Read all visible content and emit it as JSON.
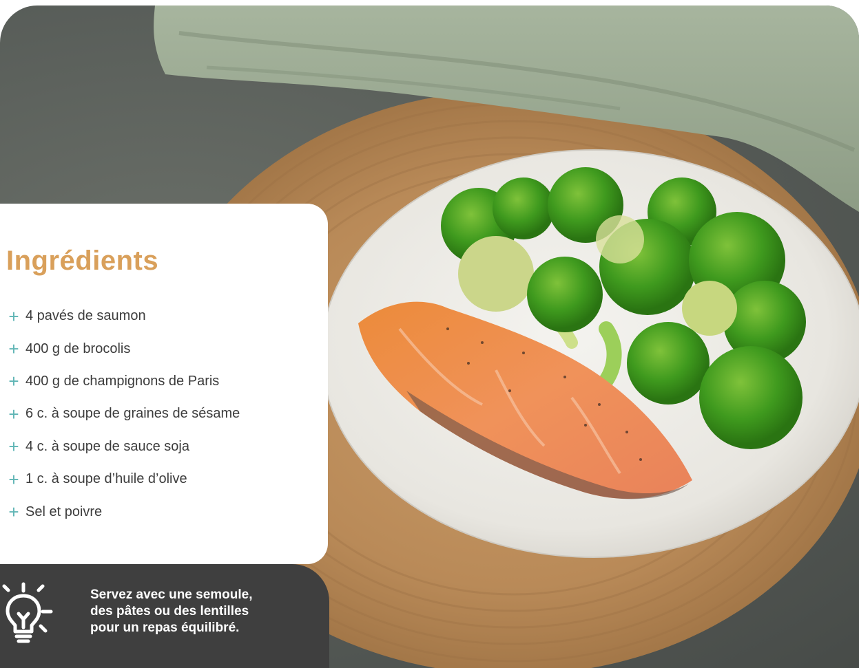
{
  "card": {
    "title": "Ingrédients",
    "ingredients": [
      "4 pavés de saumon",
      "400 g de brocolis",
      "400 g de champignons de Paris",
      "6 c. à soupe de graines de sésame",
      "4 c. à soupe de sauce soja",
      "1 c. à soupe d’huile d’olive",
      "Sel et poivre"
    ],
    "bullet_symbol": "+",
    "title_color": "#d9a05b",
    "bullet_color": "#5fb5b5"
  },
  "tip": {
    "icon": "lightbulb-icon",
    "lines": [
      "Servez avec une semoule,",
      "des pâtes ou des lentilles",
      "pour un repas équilibré."
    ],
    "background_color": "#3f3f3f"
  },
  "photo": {
    "subject": "salmon-broccoli-plate"
  }
}
